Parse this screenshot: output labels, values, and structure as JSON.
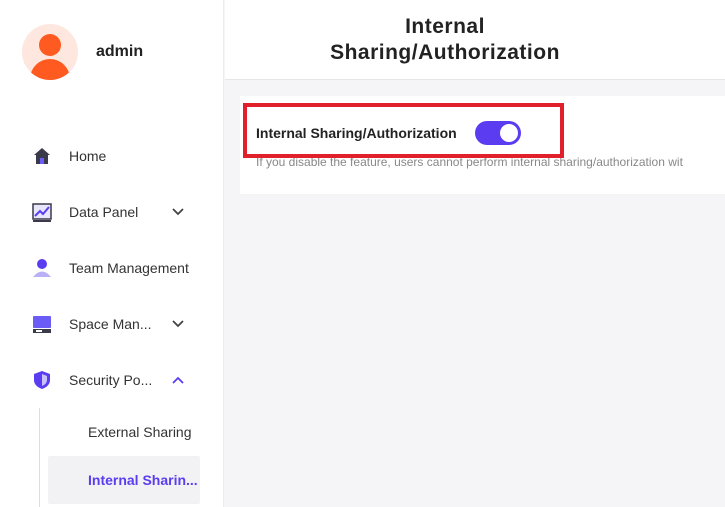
{
  "user": {
    "name": "admin"
  },
  "header": {
    "title": "Internal Sharing/Authorization"
  },
  "sidebar": {
    "items": [
      {
        "label": "Home",
        "icon": "home-icon"
      },
      {
        "label": "Data Panel",
        "icon": "chart-icon",
        "expandable": true
      },
      {
        "label": "Team Management",
        "icon": "user-icon"
      },
      {
        "label": "Space Man...",
        "icon": "storage-icon",
        "expandable": true
      },
      {
        "label": "Security Po...",
        "icon": "shield-icon",
        "expandable": true,
        "expanded": true
      }
    ],
    "subitems": [
      {
        "label": "External Sharing",
        "active": false
      },
      {
        "label": "Internal Sharin...",
        "active": true
      }
    ]
  },
  "setting": {
    "label": "Internal Sharing/Authorization",
    "enabled": true,
    "description": "If you disable the feature, users cannot perform internal sharing/authorization wit"
  },
  "colors": {
    "accent": "#5b3cf0",
    "highlight": "#e0202a",
    "avatar": "#ff5a1f"
  }
}
